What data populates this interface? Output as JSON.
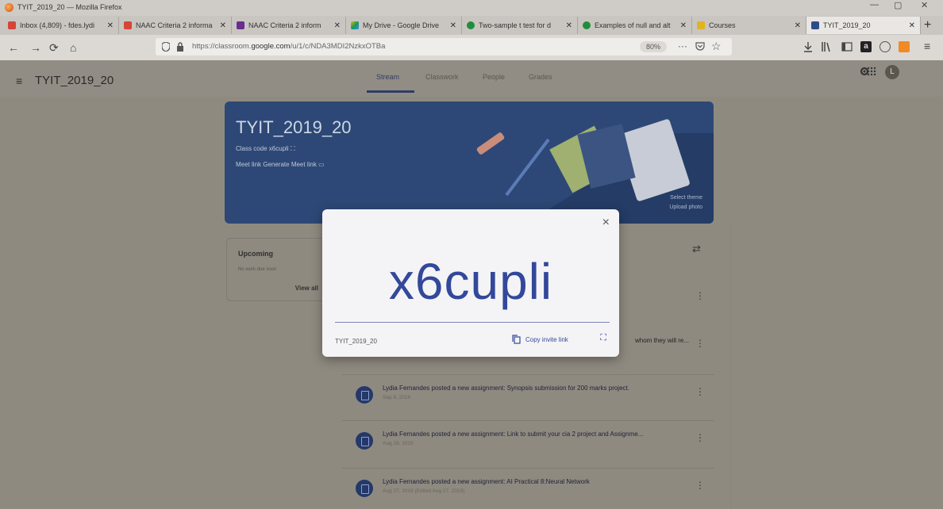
{
  "window": {
    "title": "TYIT_2019_20 — Mozilla Firefox",
    "controls": [
      "—",
      "▢",
      "✕"
    ]
  },
  "tabs": [
    {
      "label": "Inbox (4,809) - fdes.lydi",
      "color": "#d44638"
    },
    {
      "label": "NAAC Criteria 2 informa",
      "color": "#d44638"
    },
    {
      "label": "NAAC Criteria 2 inform",
      "color": "#6a2c91"
    },
    {
      "label": "My Drive - Google Drive",
      "color": "#f4b400"
    },
    {
      "label": "Two-sample t test for d",
      "color": "#1e8e3e"
    },
    {
      "label": "Examples of null and alt",
      "color": "#1e8e3e"
    },
    {
      "label": "Courses",
      "color": "#e2b320"
    },
    {
      "label": "TYIT_2019_20",
      "color": "#2f4c8a"
    }
  ],
  "nav": {
    "url_prefix": "https://classroom.",
    "url_domain": "google.com",
    "url_path": "/u/1/c/NDA3MDI2NzkxOTBa",
    "zoom": "80%",
    "more": "···"
  },
  "classroom": {
    "class_name": "TYIT_2019_20",
    "tabs": [
      "Stream",
      "Classwork",
      "People",
      "Grades"
    ],
    "avatar_letter": "L"
  },
  "banner": {
    "title": "TYIT_2019_20",
    "class_code_line": "Class code  x6cupli",
    "meet_line": "Meet link  Generate Meet link",
    "select_theme": "Select theme",
    "upload_photo": "Upload photo"
  },
  "upcoming": {
    "heading": "Upcoming",
    "subtext": "No work due soon",
    "view_all": "View all"
  },
  "stream": [
    {
      "title": "Lydia Fernandes posted a new assignment: Synopsis submission for 200 marks project.",
      "date": "Sep 9, 2019"
    },
    {
      "title": "Lydia Fernandes posted a new assignment: Link to submit your cia 2 project and Assignme...",
      "date": "Aug 29, 2019"
    },
    {
      "title": "Lydia Fernandes posted a new assignment: AI Practical 8:Neural Network",
      "date": "Aug 27, 2019 (Edited Aug 27, 2019)"
    }
  ],
  "partial_text": "whom they will re...",
  "modal": {
    "code": "x6cupli",
    "class_name": "TYIT_2019_20",
    "copy_label": "Copy invite link",
    "close": "×"
  },
  "colors": {
    "accent": "#33489b",
    "banner": "#2d4876",
    "overlay": "#8f8a80"
  }
}
